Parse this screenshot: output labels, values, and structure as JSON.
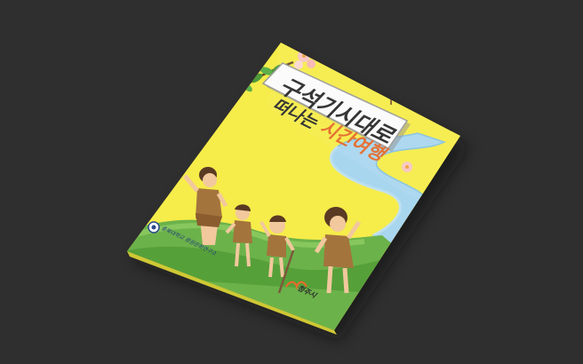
{
  "cover": {
    "title_line1": "구석기시대로",
    "title_line2_a": "떠나는",
    "title_line2_b": "시간여행",
    "publisher_left": "충북대학교 중원문화연구소",
    "publisher_right": "청주시",
    "sign_text": "",
    "colors": {
      "background": "#2f2f2f",
      "cover_yellow": "#f3e73a",
      "title_dark": "#2b2b2b",
      "title_accent": "#e46b2a",
      "river": "#a9d6ef",
      "grass": "#6cb24a"
    }
  }
}
